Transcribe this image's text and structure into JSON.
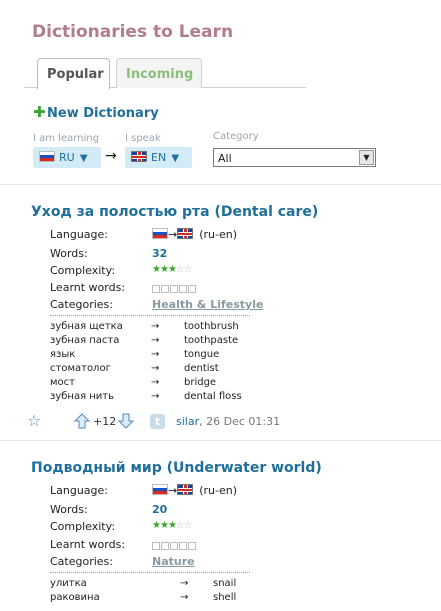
{
  "page": {
    "title": "Dictionaries to Learn"
  },
  "tabs": [
    {
      "label": "Popular",
      "active": true
    },
    {
      "label": "Incoming",
      "active": false
    }
  ],
  "actions": {
    "new_dictionary": "New Dictionary"
  },
  "filters": {
    "learning_label": "I am learning",
    "learning_value": "RU",
    "speak_label": "I speak",
    "speak_value": "EN",
    "category_label": "Category",
    "category_value": "All"
  },
  "meta_labels": {
    "language": "Language:",
    "words": "Words:",
    "complexity": "Complexity:",
    "learnt": "Learnt words:",
    "categories": "Categories:"
  },
  "dictionaries": [
    {
      "title": "Уход за полостью рта (Dental care)",
      "language_code": "(ru-en)",
      "words": "32",
      "complexity": 3,
      "category": "Health & Lifestyle",
      "entries": [
        {
          "source": "зубная щетка",
          "arrow": "→",
          "target": "toothbrush"
        },
        {
          "source": "зубная паста",
          "arrow": "→",
          "target": "toothpaste"
        },
        {
          "source": "язык",
          "arrow": "→",
          "target": "tongue"
        },
        {
          "source": "стоматолог",
          "arrow": "→",
          "target": "dentist"
        },
        {
          "source": "мост",
          "arrow": "→",
          "target": "bridge"
        },
        {
          "source": "зубная нить",
          "arrow": "→",
          "target": "dental floss"
        }
      ],
      "score": "+12",
      "author": "silar",
      "date": ", 26 Dec 01:31"
    },
    {
      "title": "Подводный мир (Underwater world)",
      "language_code": "(ru-en)",
      "words": "20",
      "complexity": 3,
      "category": "Nature",
      "entries": [
        {
          "source": "улитка",
          "arrow": "→",
          "target": "snail"
        },
        {
          "source": "раковина",
          "arrow": "→",
          "target": "shell"
        }
      ]
    }
  ],
  "icons": {
    "add": "plus-icon",
    "favorite": "star-outline-icon",
    "vote_up": "arrow-up-icon",
    "vote_down": "arrow-down-icon",
    "twitter": "twitter-icon",
    "flag_ru": "flag-ru-icon",
    "flag_gb": "flag-gb-icon"
  },
  "colors": {
    "title": "#b07d8c",
    "link": "#1f6f9a",
    "accent_green": "#3aa533",
    "select_bg": "#d3ebf7"
  }
}
